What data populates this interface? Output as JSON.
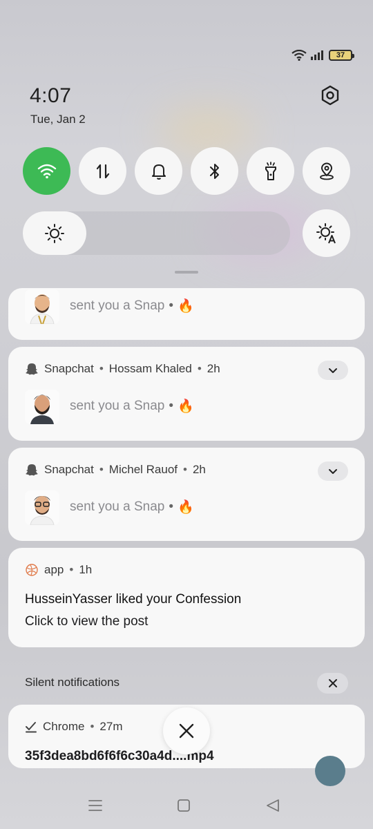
{
  "status": {
    "battery": "37"
  },
  "header": {
    "time": "4:07",
    "date": "Tue, Jan 2"
  },
  "quick_tiles": [
    {
      "icon": "wifi-icon",
      "active": true
    },
    {
      "icon": "mobile-data-icon",
      "active": false
    },
    {
      "icon": "bell-icon",
      "active": false
    },
    {
      "icon": "bluetooth-icon",
      "active": false
    },
    {
      "icon": "flashlight-icon",
      "active": false
    },
    {
      "icon": "location-icon",
      "active": false
    }
  ],
  "brightness": {
    "level": 0.22
  },
  "notifications": [
    {
      "app": "",
      "sender": "",
      "age": "",
      "text": "sent you a Snap",
      "emoji": "🔥"
    },
    {
      "app": "Snapchat",
      "sender": "Hossam Khaled",
      "age": "2h",
      "text": "sent you a Snap",
      "emoji": "🔥"
    },
    {
      "app": "Snapchat",
      "sender": "Michel Rauof",
      "age": "2h",
      "text": "sent you a Snap",
      "emoji": "🔥"
    },
    {
      "app": "app",
      "age": "1h",
      "title": "HusseinYasser liked your Confession",
      "body": "Click to view the post"
    }
  ],
  "silent": {
    "label": "Silent notifications",
    "chrome": {
      "app": "Chrome",
      "age": "27m",
      "title": "35f3dea8bd6f6f6c30a4d....mp4"
    }
  },
  "colors": {
    "accent": "#3dba55",
    "card": "#f8f8f8"
  }
}
